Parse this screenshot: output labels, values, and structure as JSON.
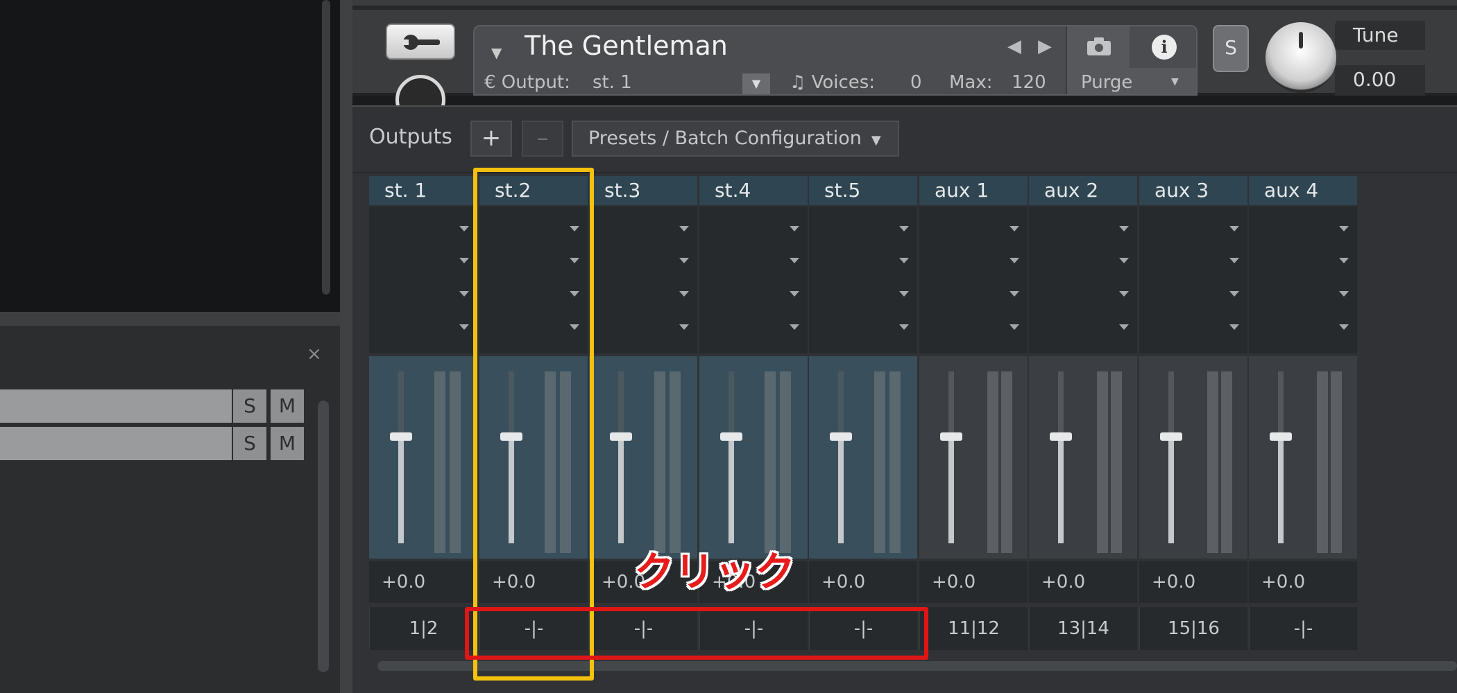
{
  "left_panel": {
    "close_glyph": "×",
    "tracks": [
      {
        "solo": "S",
        "mute": "M"
      },
      {
        "solo": "S",
        "mute": "M"
      }
    ]
  },
  "header": {
    "instrument_name": "The Gentleman",
    "output_label": "€ Output:",
    "output_value": "st. 1",
    "voices_label": "♫ Voices:",
    "voices_value": "0",
    "max_label": "Max:",
    "max_value": "120",
    "purge_label": "Purge",
    "solo_label": "S",
    "tune_label": "Tune",
    "tune_value": "0.00",
    "info_glyph": "i",
    "dropdown_glyph": "▼"
  },
  "outputs": {
    "label": "Outputs",
    "add_label": "+",
    "remove_label": "–",
    "presets_label": "Presets / Batch Configuration",
    "presets_caret": "▼"
  },
  "channels": [
    {
      "name": "st. 1",
      "level": "+0.0",
      "routing": "1|2",
      "kind": "stereo"
    },
    {
      "name": "st.2",
      "level": "+0.0",
      "routing": "-|-",
      "kind": "stereo"
    },
    {
      "name": "st.3",
      "level": "+0.0",
      "routing": "-|-",
      "kind": "stereo"
    },
    {
      "name": "st.4",
      "level": "+0.0",
      "routing": "-|-",
      "kind": "stereo"
    },
    {
      "name": "st.5",
      "level": "+0.0",
      "routing": "-|-",
      "kind": "stereo"
    },
    {
      "name": "aux 1",
      "level": "+0.0",
      "routing": "11|12",
      "kind": "aux"
    },
    {
      "name": "aux 2",
      "level": "+0.0",
      "routing": "13|14",
      "kind": "aux"
    },
    {
      "name": "aux 3",
      "level": "+0.0",
      "routing": "15|16",
      "kind": "aux"
    },
    {
      "name": "aux 4",
      "level": "+0.0",
      "routing": "-|-",
      "kind": "aux"
    }
  ],
  "annotation": {
    "click_label": "クリック",
    "highlight_color": "#f4c20d",
    "emphasis_color": "#e01616"
  },
  "colors": {
    "channel_header": "#2f4552",
    "stereo_fader_bg": "#3a4f5c",
    "aux_fader_bg": "#3b3f43"
  }
}
